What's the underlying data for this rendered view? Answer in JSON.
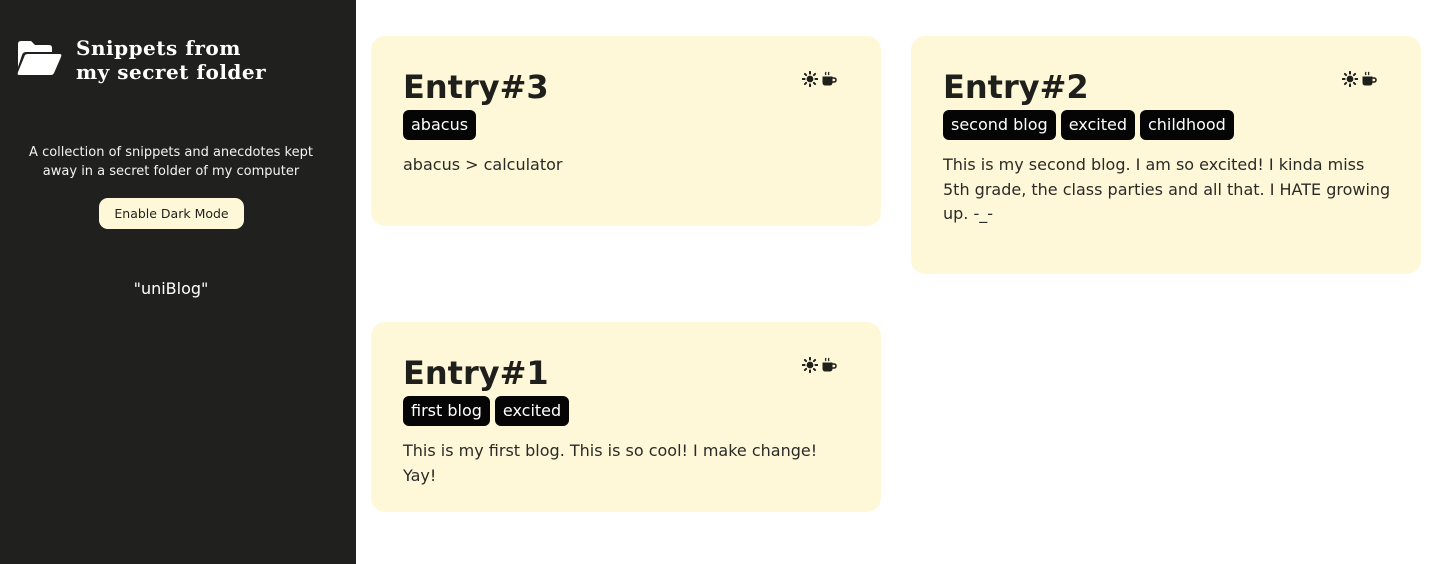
{
  "sidebar": {
    "title_line1": "Snippets from",
    "title_line2": "my secret folder",
    "logo_icon": "folder-open-icon",
    "tagline": "A collection of snippets and anecdotes kept away in a secret folder of my computer",
    "dark_mode_label": "Enable Dark Mode",
    "footer": "\"uniBlog\""
  },
  "entries": [
    {
      "title": "Entry#3",
      "tags": [
        "abacus"
      ],
      "body": "abacus > calculator",
      "icons": [
        "sun-icon",
        "coffee-icon"
      ]
    },
    {
      "title": "Entry#2",
      "tags": [
        "second blog",
        "excited",
        "childhood"
      ],
      "body": "This is my second blog. I am so excited! I kinda miss 5th grade, the class parties and all that. I HATE growing up. -_-",
      "icons": [
        "sun-icon",
        "coffee-icon"
      ]
    },
    {
      "title": "Entry#1",
      "tags": [
        "first blog",
        "excited"
      ],
      "body": "This is my first blog. This is so cool! I make change! Yay!",
      "icons": [
        "sun-icon",
        "coffee-icon"
      ]
    }
  ],
  "colors": {
    "sidebar_bg": "#20201e",
    "card_bg": "#fef8d9",
    "tag_bg": "#050505",
    "text": "#1f1f1c"
  }
}
